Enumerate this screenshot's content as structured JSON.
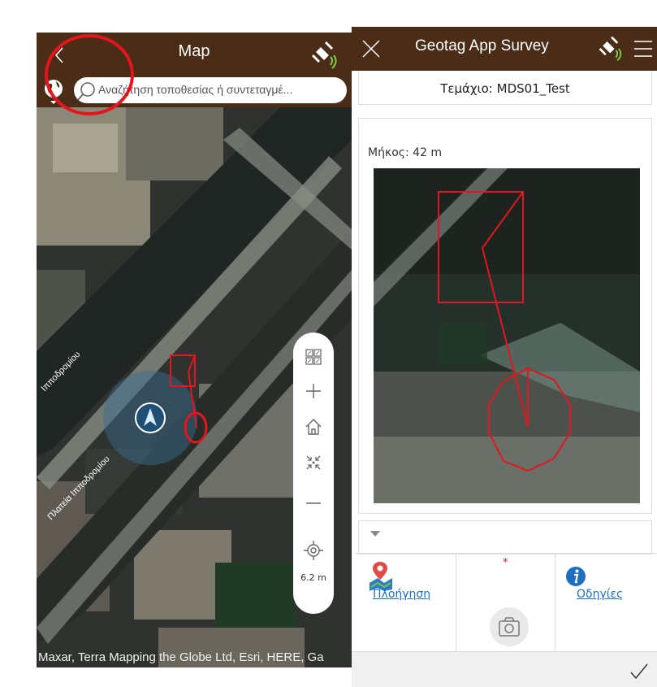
{
  "map_screen": {
    "title": "Map",
    "search": {
      "placeholder": "Αναζήτηση τοποθεσίας ή συντεταγμέ..."
    },
    "street_labels": [
      "Πλατεία Ιπποδρομίου",
      "Ιπποδρομίου"
    ],
    "scale": "6.2 m",
    "attribution": "Maxar, Terra Mapping the Globe Ltd, Esri, HERE, Ga",
    "icons": [
      "back-icon",
      "gps-icon",
      "globe-icon",
      "search-icon",
      "basemap-icon",
      "zoom-in-icon",
      "home-icon",
      "collapse-icon",
      "zoom-out-icon",
      "locate-icon",
      "navigation-arrow-icon"
    ]
  },
  "survey_screen": {
    "title": "Geotag App Survey",
    "parcel": {
      "label": "Τεμάχιο:",
      "value": "MDS01_Test"
    },
    "length": {
      "label": "Μήκος:",
      "value": "42 m"
    },
    "required_marker": "*",
    "actions": {
      "navigation_label": "Πλοήγηση",
      "instructions_label": "Οδηγίες"
    },
    "icons": [
      "close-icon",
      "gps-icon",
      "menu-icon",
      "collapse-arrow-icon",
      "map-pin-icon",
      "camera-icon",
      "info-icon",
      "check-icon"
    ]
  },
  "colors": {
    "header_brown": "#4b2c17",
    "annotation_red": "#e4151c",
    "link_blue": "#1a6fd1"
  }
}
